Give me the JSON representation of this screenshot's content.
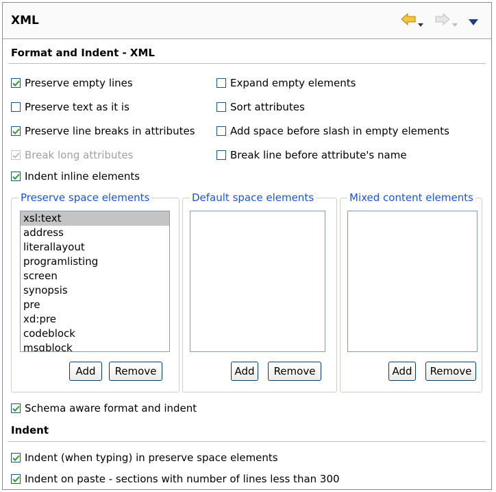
{
  "header": {
    "title": "XML",
    "back_icon": "back-arrow-icon",
    "forward_icon": "forward-arrow-icon",
    "menu_icon": "view-menu-icon"
  },
  "section1": {
    "title": "Format and Indent - XML"
  },
  "options": {
    "preserve_empty_lines": {
      "label": "Preserve empty lines",
      "checked": true
    },
    "preserve_text": {
      "label": "Preserve text as it is",
      "checked": false
    },
    "preserve_line_breaks": {
      "label": "Preserve line breaks in attributes",
      "checked": true
    },
    "break_long_attributes": {
      "label": "Break long attributes",
      "checked": true,
      "disabled": true
    },
    "indent_inline": {
      "label": "Indent inline elements",
      "checked": true
    },
    "expand_empty": {
      "label": "Expand empty elements",
      "checked": false
    },
    "sort_attributes": {
      "label": "Sort attributes",
      "checked": false
    },
    "add_space_slash": {
      "label": "Add space before slash in empty elements",
      "checked": false
    },
    "break_before_attr": {
      "label": "Break line before attribute's name",
      "checked": false
    }
  },
  "groups": {
    "preserve_space": {
      "title": "Preserve space elements",
      "items": [
        "xsl:text",
        "address",
        "literallayout",
        "programlisting",
        "screen",
        "synopsis",
        "pre",
        "xd:pre",
        "codeblock",
        "msgblock"
      ],
      "selected_index": 0,
      "add_label": "Add",
      "remove_label": "Remove"
    },
    "default_space": {
      "title": "Default space elements",
      "items": [],
      "add_label": "Add",
      "remove_label": "Remove"
    },
    "mixed_content": {
      "title": "Mixed content elements",
      "items": [],
      "add_label": "Add",
      "remove_label": "Remove"
    }
  },
  "schema_aware": {
    "label": "Schema aware format and indent",
    "checked": true
  },
  "section2": {
    "title": "Indent"
  },
  "indent_options": {
    "indent_typing": {
      "label": "Indent (when typing) in preserve space elements",
      "checked": true
    },
    "indent_paste": {
      "label": "Indent on paste - sections with number of lines less than 300",
      "checked": true
    }
  },
  "colors": {
    "group_title": "#1d53d8",
    "checkbox_border": "#1c5180",
    "checkmark": "#21a121",
    "arrow_fill": "#f5c43a",
    "selected_item": "#c4c4c4"
  }
}
